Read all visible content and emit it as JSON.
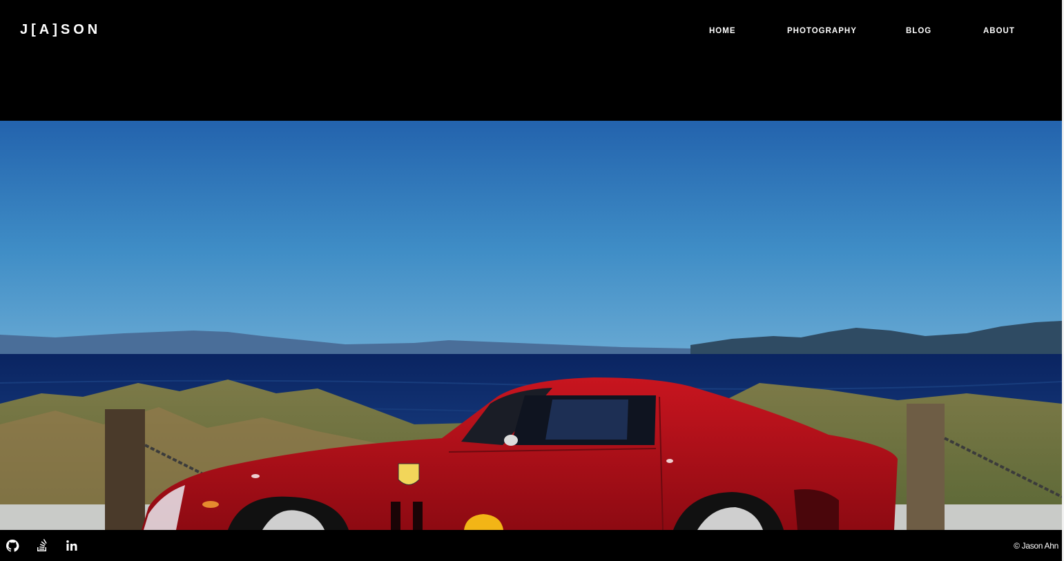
{
  "site": {
    "logo_text": "J[A]SON"
  },
  "nav": {
    "items": [
      {
        "label": "HOME"
      },
      {
        "label": "PHOTOGRAPHY"
      },
      {
        "label": "BLOG"
      },
      {
        "label": "ABOUT"
      }
    ]
  },
  "hero": {
    "image_subject": "red-sports-car-by-ocean-photo"
  },
  "footer": {
    "social_icons": [
      "github-icon",
      "stack-overflow-icon",
      "linkedin-icon"
    ],
    "copyright": "© Jason Ahn"
  },
  "colors": {
    "background": "#000000",
    "text": "#ffffff",
    "car_red": "#b3111b",
    "sea_blue": "#0d2a6b",
    "sky_blue": "#3a84c2"
  }
}
